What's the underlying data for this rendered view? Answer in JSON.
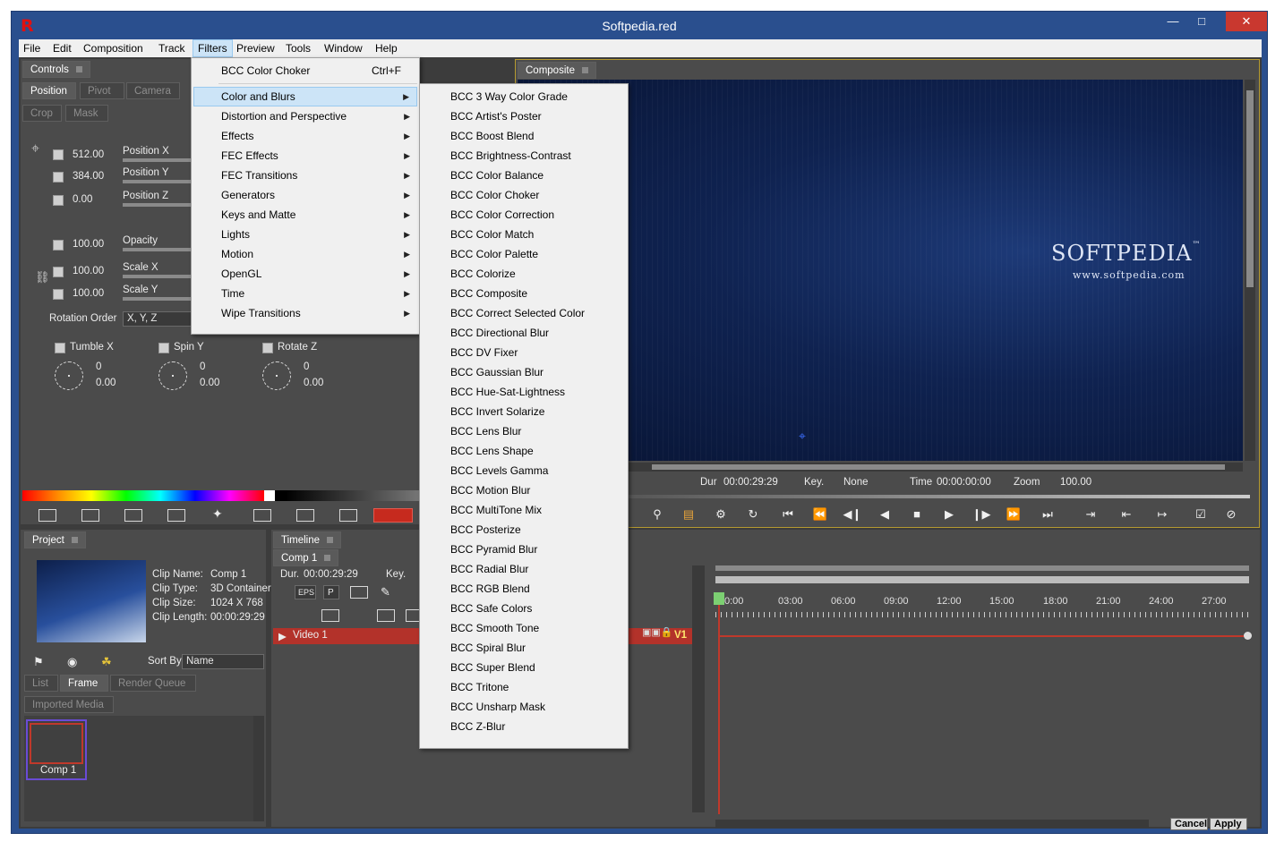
{
  "window": {
    "title": "Softpedia.red",
    "logo": "R",
    "controls": [
      "minimize-icon",
      "maximize-icon",
      "close-icon"
    ]
  },
  "menubar": [
    "File",
    "Edit",
    "Composition",
    "Track",
    "Filters",
    "Preview",
    "Tools",
    "Window",
    "Help"
  ],
  "controls_panel": {
    "tab": "Controls",
    "subtabs": [
      "Position",
      "Pivot",
      "Camera"
    ],
    "subtabs2": [
      "Crop",
      "Mask"
    ],
    "params": [
      {
        "value": "512.00",
        "label": "Position X"
      },
      {
        "value": "384.00",
        "label": "Position Y"
      },
      {
        "value": "0.00",
        "label": "Position Z"
      },
      {
        "value": "100.00",
        "label": "Opacity"
      },
      {
        "value": "100.00",
        "label": "Scale X"
      },
      {
        "value": "100.00",
        "label": "Scale Y"
      }
    ],
    "rotation_order_label": "Rotation Order",
    "rotation_order_value": "X, Y, Z",
    "rotations": [
      {
        "label": "Tumble X",
        "v1": "0",
        "v2": "0.00"
      },
      {
        "label": "Spin Y",
        "v1": "0",
        "v2": "0.00"
      },
      {
        "label": "Rotate Z",
        "v1": "0",
        "v2": "0.00"
      }
    ]
  },
  "filters_menu": {
    "items": [
      {
        "label": "BCC Color Choker",
        "shortcut": "Ctrl+F"
      },
      {
        "label": "Color and Blurs",
        "submenu": true
      },
      {
        "label": "Distortion and Perspective",
        "submenu": true
      },
      {
        "label": "Effects",
        "submenu": true
      },
      {
        "label": "FEC Effects",
        "submenu": true
      },
      {
        "label": "FEC Transitions",
        "submenu": true
      },
      {
        "label": "Generators",
        "submenu": true
      },
      {
        "label": "Keys and Matte",
        "submenu": true
      },
      {
        "label": "Lights",
        "submenu": true
      },
      {
        "label": "Motion",
        "submenu": true
      },
      {
        "label": "OpenGL",
        "submenu": true
      },
      {
        "label": "Time",
        "submenu": true
      },
      {
        "label": "Wipe Transitions",
        "submenu": true
      }
    ]
  },
  "submenu": [
    "BCC 3 Way Color Grade",
    "BCC Artist's Poster",
    "BCC Boost Blend",
    "BCC Brightness-Contrast",
    "BCC Color Balance",
    "BCC Color Choker",
    "BCC Color Correction",
    "BCC Color Match",
    "BCC Color Palette",
    "BCC Colorize",
    "BCC Composite",
    "BCC Correct Selected Color",
    "BCC Directional Blur",
    "BCC DV Fixer",
    "BCC Gaussian Blur",
    "BCC Hue-Sat-Lightness",
    "BCC Invert Solarize",
    "BCC Lens Blur",
    "BCC Lens Shape",
    "BCC Levels Gamma",
    "BCC Motion Blur",
    "BCC MultiTone Mix",
    "BCC Posterize",
    "BCC Pyramid Blur",
    "BCC Radial Blur",
    "BCC RGB Blend",
    "BCC Safe Colors",
    "BCC Smooth Tone",
    "BCC Spiral Blur",
    "BCC Super Blend",
    "BCC Tritone",
    "BCC Unsharp Mask",
    "BCC Z-Blur"
  ],
  "composite": {
    "tab": "Composite",
    "watermark": "SOFTPEDIA",
    "watermark_tm": "™",
    "watermark_url": "www.softpedia.com",
    "dur_label": "Dur",
    "dur_value": "00:00:29:29",
    "key_label": "Key.",
    "key_value": "None",
    "time_label": "Time",
    "time_value": "00:00:00:00",
    "zoom_label": "Zoom",
    "zoom_value": "100.00"
  },
  "project_panel": {
    "tab": "Project",
    "clip_name_label": "Clip Name:",
    "clip_name": "Comp 1",
    "clip_type_label": "Clip Type:",
    "clip_type": "3D Container",
    "clip_size_label": "Clip Size:",
    "clip_size": "1024 X 768",
    "clip_length_label": "Clip Length:",
    "clip_length": "00:00:29:29",
    "sort_by_label": "Sort By",
    "sort_by_value": "Name",
    "view_tabs": [
      "List",
      "Frame",
      "Render Queue"
    ],
    "media_tab": "Imported Media",
    "item_label": "Comp 1"
  },
  "timeline_panel": {
    "tab": "Timeline",
    "comp_tab": "Comp 1",
    "dur_label": "Dur.",
    "dur_value": "00:00:29:29",
    "key_label": "Key.",
    "eps_label": "EPS",
    "p_label": "P",
    "track_name": "Video 1",
    "track_code": "V1",
    "ruler": [
      "0:00",
      "03:00",
      "06:00",
      "09:00",
      "12:00",
      "15:00",
      "18:00",
      "21:00",
      "24:00",
      "27:00"
    ]
  },
  "buttons": {
    "cancel": "Cancel",
    "apply": "Apply"
  },
  "colors": {
    "accent_red": "#c0392b",
    "menu_highlight": "#cce4f7",
    "titlebar": "#2a4f8e"
  }
}
